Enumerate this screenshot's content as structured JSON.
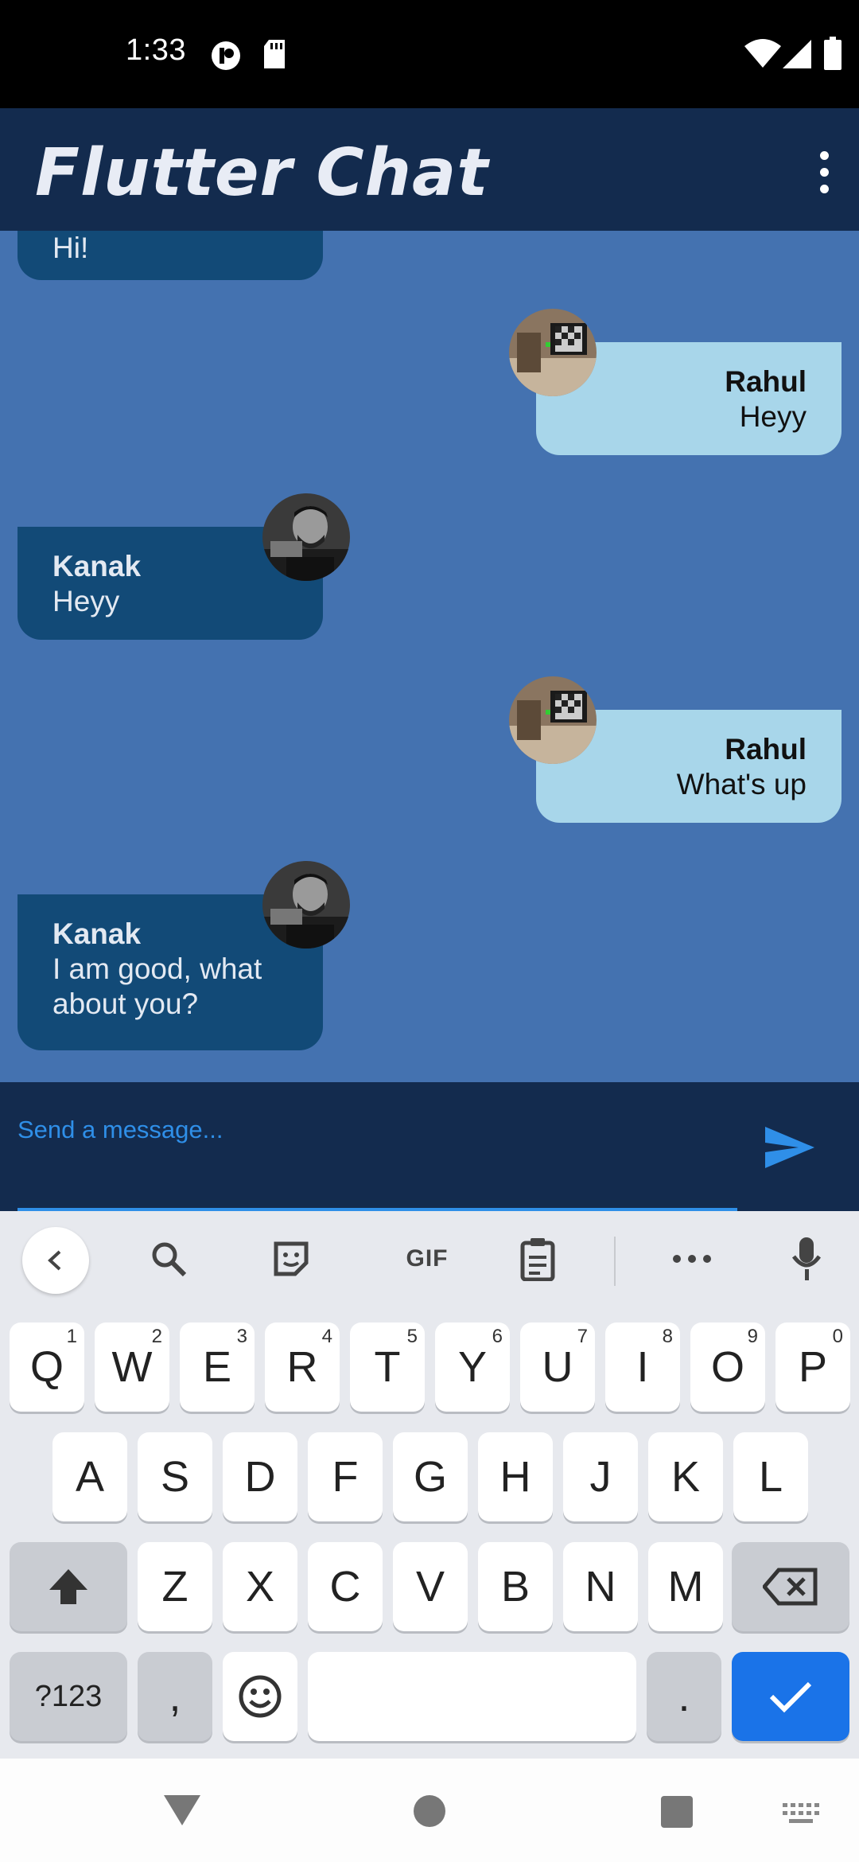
{
  "status_bar": {
    "time": "1:33",
    "icons": [
      "privacy-icon",
      "sd-card-icon",
      "wifi-icon",
      "signal-icon",
      "battery-icon"
    ]
  },
  "app_bar": {
    "title": "Flutter Chat",
    "menu_icon": "more-vert-icon"
  },
  "messages": [
    {
      "sender": "",
      "text": "Hi!",
      "direction": "received"
    },
    {
      "sender": "Rahul",
      "text": "Heyy",
      "direction": "sent"
    },
    {
      "sender": "Kanak",
      "text": "Heyy",
      "direction": "received"
    },
    {
      "sender": "Rahul",
      "text": "What's up",
      "direction": "sent"
    },
    {
      "sender": "Kanak",
      "text": "I am good, what about you?",
      "direction": "received"
    }
  ],
  "composer": {
    "placeholder": "Send a message...",
    "send_icon": "send-icon"
  },
  "keyboard": {
    "toolbar": {
      "gif_label": "GIF"
    },
    "row1": [
      "Q",
      "W",
      "E",
      "R",
      "T",
      "Y",
      "U",
      "I",
      "O",
      "P"
    ],
    "row1_hints": [
      "1",
      "2",
      "3",
      "4",
      "5",
      "6",
      "7",
      "8",
      "9",
      "0"
    ],
    "row2": [
      "A",
      "S",
      "D",
      "F",
      "G",
      "H",
      "J",
      "K",
      "L"
    ],
    "row3": [
      "Z",
      "X",
      "C",
      "V",
      "B",
      "N",
      "M"
    ],
    "symbols_label": "?123",
    "comma_label": ",",
    "period_label": "."
  },
  "colors": {
    "app_bar": "#132b4e",
    "chat_background": "#4472b0",
    "received_bubble": "#124a77",
    "sent_bubble": "#a8d6ea",
    "accent": "#2f8fe8"
  }
}
